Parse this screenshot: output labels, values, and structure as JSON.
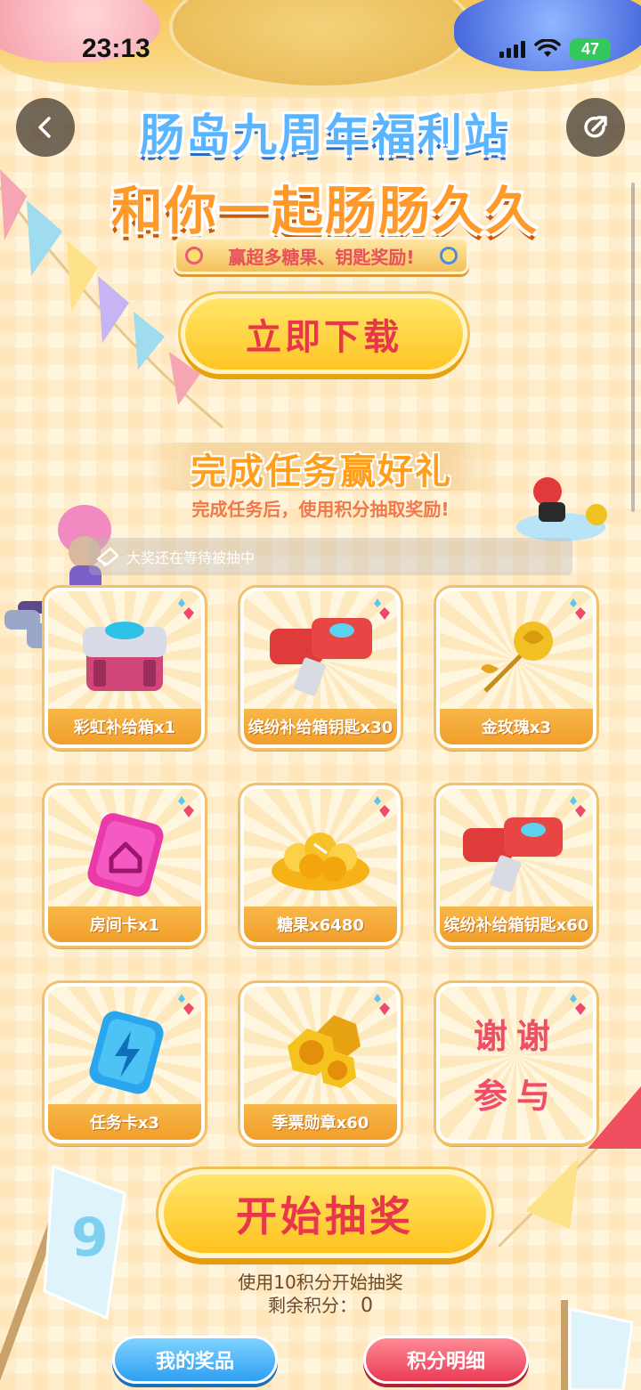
{
  "status_bar": {
    "time": "23:13",
    "battery": "47"
  },
  "header": {
    "title_line1": "肠岛九周年福利站",
    "title_line2": "和你一起肠肠久久",
    "subtitle": "赢超多糖果、钥匙奖励!"
  },
  "download_button": "立即下载",
  "task_section": {
    "title": "完成任务赢好礼",
    "subtitle": "完成任务后，使用积分抽取奖励!"
  },
  "ticker_text": "大奖还在等待被抽中",
  "prizes": [
    {
      "label": "彩虹补给箱x1",
      "icon": "rainbow-supply-box-icon"
    },
    {
      "label": "缤纷补给箱钥匙x30",
      "icon": "supply-box-key-icon"
    },
    {
      "label": "金玫瑰x3",
      "icon": "gold-rose-icon"
    },
    {
      "label": "房间卡x1",
      "icon": "room-card-icon"
    },
    {
      "label": "糖果x6480",
      "icon": "candy-icon"
    },
    {
      "label": "缤纷补给箱钥匙x60",
      "icon": "supply-box-key-icon"
    },
    {
      "label": "任务卡x3",
      "icon": "task-card-icon"
    },
    {
      "label": "季票勋章x60",
      "icon": "season-medal-icon"
    },
    {
      "label_line1": "谢谢",
      "label_line2": "参与"
    }
  ],
  "draw_button": "开始抽奖",
  "draw_cost": "使用10积分开始抽奖",
  "remaining_points": {
    "label": "剩余积分：",
    "value": "0"
  },
  "bottom_buttons": {
    "my_prizes": "我的奖品",
    "points_detail": "积分明细"
  },
  "colors": {
    "accent": "#ffc523",
    "title_blue": "#5ab4ff",
    "title_orange": "#ff9a2a",
    "red_text": "#e8364a"
  }
}
